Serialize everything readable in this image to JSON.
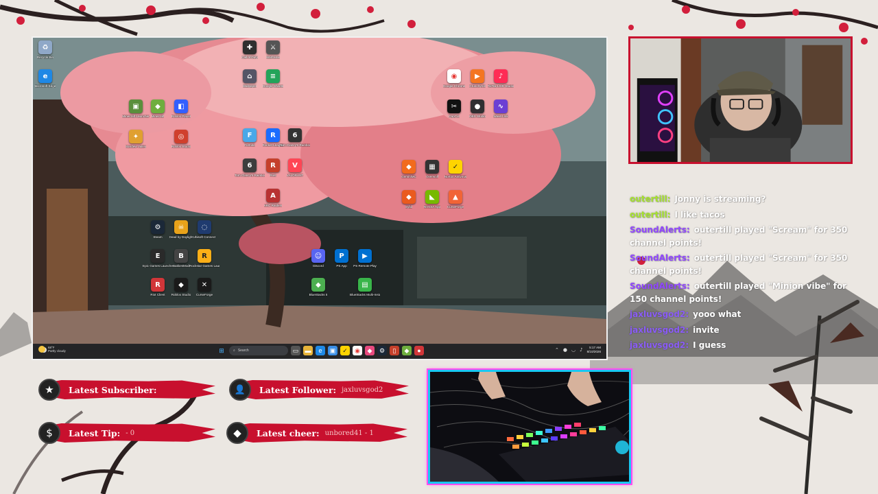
{
  "desktop": {
    "icons": [
      {
        "label": "Recycle Bin",
        "glyph": "♻",
        "color": "#8fa8c8"
      },
      {
        "label": "Microsoft Edge",
        "glyph": "e",
        "color": "#1e88e5"
      },
      {
        "label": "Minecraft Launcher",
        "glyph": "▣",
        "color": "#5a8f3c"
      },
      {
        "label": "Minecraft",
        "glyph": "◆",
        "color": "#6fae3e"
      },
      {
        "label": "Roblox Player",
        "glyph": "◧",
        "color": "#335fff"
      },
      {
        "label": "Stardew Valley",
        "glyph": "✦",
        "color": "#e0a030"
      },
      {
        "label": "Roblox Studio",
        "glyph": "◎",
        "color": "#d0402d"
      },
      {
        "label": "Call of Duty",
        "glyph": "✚",
        "color": "#2f2f2f"
      },
      {
        "label": "Warframe",
        "glyph": "⚔",
        "color": "#555"
      },
      {
        "label": "Wallpaper",
        "glyph": "⌂",
        "color": "#556"
      },
      {
        "label": "Google Sheets",
        "glyph": "≡",
        "color": "#23a45a"
      },
      {
        "label": "Fortnite",
        "glyph": "F",
        "color": "#4aa8e8"
      },
      {
        "label": "Rocket League",
        "glyph": "R",
        "color": "#1b6cff"
      },
      {
        "label": "Tom Clancy's Rainbow Six",
        "glyph": "6",
        "color": "#333"
      },
      {
        "label": "Tom Clancy's Rainbow Six",
        "glyph": "6",
        "color": "#3d3d3d"
      },
      {
        "label": "Rust",
        "glyph": "R",
        "color": "#c5402b"
      },
      {
        "label": "VALORANT",
        "glyph": "V",
        "color": "#ff4655"
      },
      {
        "label": "ARC Raiders",
        "glyph": "A",
        "color": "#b83232"
      },
      {
        "label": "Google Chrome",
        "glyph": "◉",
        "color": "#ffffff"
      },
      {
        "label": "Crunchyroll",
        "glyph": "▶",
        "color": "#f47521"
      },
      {
        "label": "TikTok LIVE Studio",
        "glyph": "♪",
        "color": "#fe2c55"
      },
      {
        "label": "CapCut",
        "glyph": "✂",
        "color": "#111"
      },
      {
        "label": "OBS Studio",
        "glyph": "●",
        "color": "#302e31"
      },
      {
        "label": "Wave Link",
        "glyph": "∿",
        "color": "#6b3fd4"
      },
      {
        "label": "GeminiMC",
        "glyph": "◆",
        "color": "#f26b1d"
      },
      {
        "label": "Overwolf",
        "glyph": "▦",
        "color": "#333"
      },
      {
        "label": "Norton Antivirus",
        "glyph": "✓",
        "color": "#ffd400"
      },
      {
        "label": "Sybil",
        "glyph": "◆",
        "color": "#ea5a1e"
      },
      {
        "label": "NVIDIA App",
        "glyph": "◣",
        "color": "#76b900"
      },
      {
        "label": "CurseForge",
        "glyph": "▲",
        "color": "#f16436"
      },
      {
        "label": "Steam",
        "glyph": "⚙",
        "color": "#1b2838"
      },
      {
        "label": "Dead by Daylight",
        "glyph": "☠",
        "color": "#e8a21a"
      },
      {
        "label": "Ubisoft Connect",
        "glyph": "◌",
        "color": "#1f3b6f"
      },
      {
        "label": "Epic Games Launcher",
        "glyph": "E",
        "color": "#2a2a2a"
      },
      {
        "label": "BakkesMod",
        "glyph": "B",
        "color": "#444"
      },
      {
        "label": "Rockstar Games Launcher",
        "glyph": "R",
        "color": "#fcaf17"
      },
      {
        "label": "Discord",
        "glyph": "☺",
        "color": "#5865f2"
      },
      {
        "label": "PS App",
        "glyph": "P",
        "color": "#0070d1"
      },
      {
        "label": "PS Remote Play",
        "glyph": "▶",
        "color": "#0070d1"
      },
      {
        "label": "Riot Client",
        "glyph": "R",
        "color": "#d13639"
      },
      {
        "label": "Roblox Studio",
        "glyph": "◆",
        "color": "#1a1a1a"
      },
      {
        "label": "CurseForge",
        "glyph": "✕",
        "color": "#1a1a1a"
      },
      {
        "label": "BlueStacks 5",
        "glyph": "◆",
        "color": "#4caf50"
      },
      {
        "label": "BlueStacks Multi-Instance",
        "glyph": "▤",
        "color": "#39b54a"
      }
    ],
    "taskbar": {
      "weather_temp": "68°F",
      "weather_desc": "Partly cloudy",
      "search_placeholder": "Search",
      "clock_time": "5:17 AM",
      "clock_date": "8/10/2026"
    }
  },
  "chat": [
    {
      "user": "outertill:",
      "text": "Jonny is streaming?",
      "color": "#a6e22e"
    },
    {
      "user": "outertill:",
      "text": "I like tacos",
      "color": "#a6e22e"
    },
    {
      "user": "SoundAlerts:",
      "text": "outertill played \"Scream\" for 350 channel points!",
      "color": "#9147ff"
    },
    {
      "user": "SoundAlerts:",
      "text": "outertill played \"Scream\" for 350 channel points!",
      "color": "#9147ff"
    },
    {
      "user": "SoundAlerts:",
      "text": "outertill played \"Minion vibe\" for 150 channel points!",
      "color": "#9147ff"
    },
    {
      "user": "jaxluvsgod2:",
      "text": "yooo what",
      "color": "#8a5cf6"
    },
    {
      "user": "jaxluvsgod2:",
      "text": "invite",
      "color": "#8a5cf6"
    },
    {
      "user": "jaxluvsgod2:",
      "text": "I guess",
      "color": "#8a5cf6"
    }
  ],
  "alerts": {
    "subscriber": {
      "label": "Latest Subscriber:",
      "value": "",
      "icon": "★"
    },
    "follower": {
      "label": "Latest Follower:",
      "value": "jaxluvsgod2",
      "icon": "👤"
    },
    "tip": {
      "label": "Latest Tip:",
      "value": "- 0",
      "icon": "$"
    },
    "cheer": {
      "label": "Latest cheer:",
      "value": "unbored41 - 1",
      "icon": "◆"
    }
  },
  "colors": {
    "accent_red": "#c8102e",
    "handcam_border": "#19c7f2",
    "handcam_glow": "#ff4df1"
  }
}
